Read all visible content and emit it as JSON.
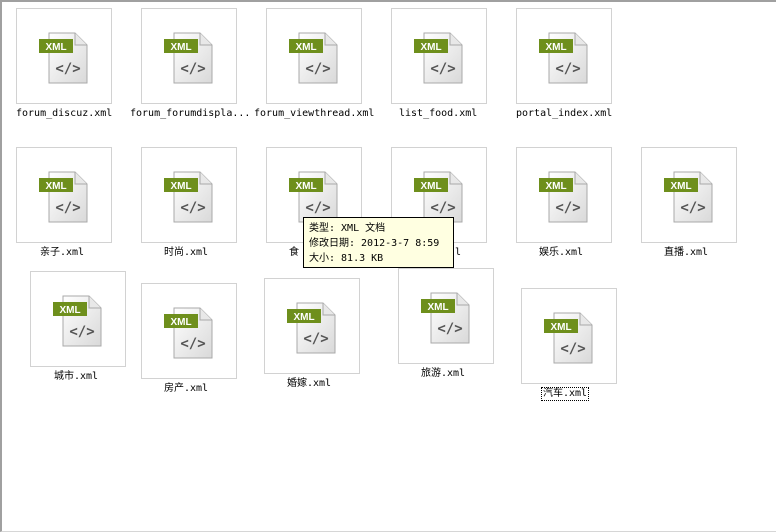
{
  "files": [
    {
      "name": "forum_discuz.xml"
    },
    {
      "name": "forum_forumdispla..."
    },
    {
      "name": "forum_viewthread.xml"
    },
    {
      "name": "list_food.xml"
    },
    {
      "name": "portal_index.xml"
    },
    {
      "name": "亲子.xml"
    },
    {
      "name": "时尚.xml"
    },
    {
      "name": "食"
    },
    {
      "name": "l"
    },
    {
      "name": "娱乐.xml"
    },
    {
      "name": "直播.xml"
    },
    {
      "name": "城市.xml"
    },
    {
      "name": "房产.xml"
    },
    {
      "name": "婚嫁.xml"
    },
    {
      "name": "旅游.xml"
    },
    {
      "name": "汽车.xml"
    }
  ],
  "icon": {
    "badge_text": "XML",
    "badge_color": "#6e8f1c",
    "symbol": "</>"
  },
  "tooltip": {
    "type_line": "类型: XML 文档",
    "date_line": "修改日期: 2012-3-7 8:59",
    "size_line": "大小: 81.3 KB"
  }
}
